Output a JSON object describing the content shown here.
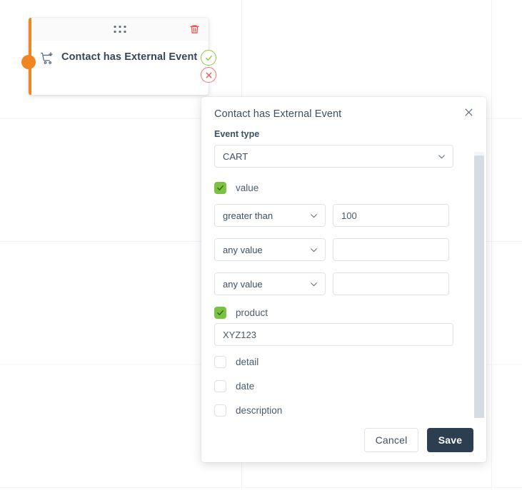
{
  "node": {
    "title": "Contact has External Event",
    "icon": "cart-plus-icon",
    "drag_handle_icon": "drag-handle-dots-icon",
    "delete_icon": "trash-icon",
    "port_yes_icon": "check-circle-icon",
    "port_no_icon": "x-circle-icon",
    "accent_color": "#f08521"
  },
  "modal": {
    "title": "Contact has External Event",
    "close_icon": "close-icon",
    "field_label": "Event type",
    "event_type": {
      "value": "CART",
      "chevron_icon": "chevron-down-icon"
    },
    "groups": [
      {
        "id": "value",
        "label": "value",
        "checked": true,
        "conditions": [
          {
            "operator": "greater than",
            "value": "100",
            "placeholder": ""
          },
          {
            "operator": "any value",
            "value": "",
            "placeholder": ""
          },
          {
            "operator": "any value",
            "value": "",
            "placeholder": ""
          }
        ]
      },
      {
        "id": "product",
        "label": "product",
        "checked": true,
        "input_value": "XYZ123",
        "input_placeholder": ""
      },
      {
        "id": "detail",
        "label": "detail",
        "checked": false
      },
      {
        "id": "date",
        "label": "date",
        "checked": false
      },
      {
        "id": "description",
        "label": "description",
        "checked": false
      }
    ],
    "footer": {
      "cancel_label": "Cancel",
      "save_label": "Save"
    },
    "checkbox_on_color": "#7cc242",
    "save_button_color": "#2c3e50"
  }
}
